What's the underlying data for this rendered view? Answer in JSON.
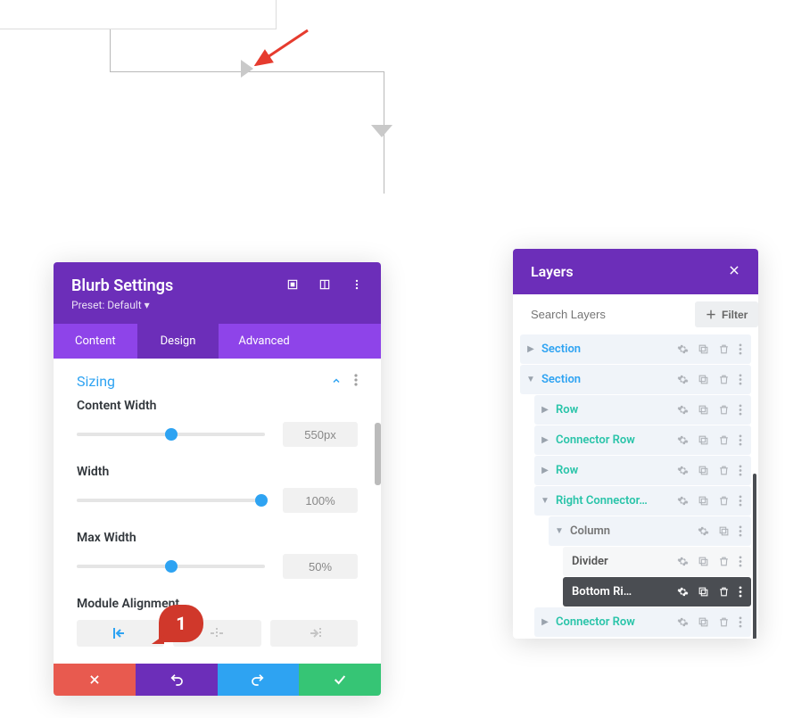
{
  "annotation": {
    "number": "1"
  },
  "settings": {
    "title": "Blurb Settings",
    "preset": "Preset: Default ▾",
    "tabs": {
      "content": "Content",
      "design": "Design",
      "advanced": "Advanced"
    },
    "section_title": "Sizing",
    "content_width": {
      "label": "Content Width",
      "value": "550px",
      "slider_percent": 50
    },
    "width": {
      "label": "Width",
      "value": "100%",
      "slider_percent": 100
    },
    "max_width": {
      "label": "Max Width",
      "value": "50%",
      "slider_percent": 50
    },
    "module_alignment_label": "Module Alignment"
  },
  "layers": {
    "title": "Layers",
    "search_placeholder": "Search Layers",
    "filter_label": "Filter",
    "rows": [
      {
        "kind": "section",
        "label": "Section",
        "expanded": false
      },
      {
        "kind": "section",
        "label": "Section",
        "expanded": true
      },
      {
        "kind": "row",
        "label": "Row",
        "expanded": false
      },
      {
        "kind": "row",
        "label": "Connector Row",
        "expanded": false
      },
      {
        "kind": "row",
        "label": "Row",
        "expanded": false
      },
      {
        "kind": "row",
        "label": "Right Connector…",
        "expanded": true
      },
      {
        "kind": "col",
        "label": "Column",
        "expanded": true
      },
      {
        "kind": "mod",
        "label": "Divider",
        "active": false
      },
      {
        "kind": "mod",
        "label": "Bottom Ri…",
        "active": true
      },
      {
        "kind": "row",
        "label": "Connector Row",
        "expanded": false
      }
    ]
  }
}
